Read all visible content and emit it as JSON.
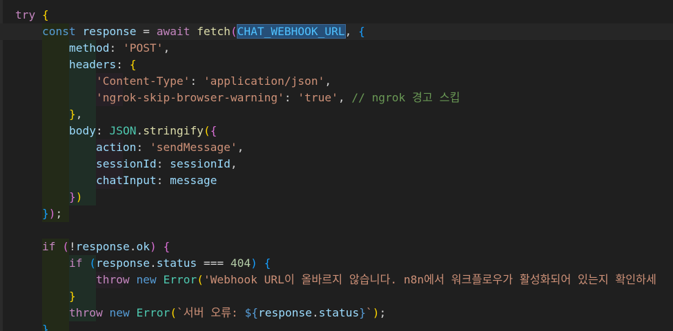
{
  "editor": {
    "language": "javascript",
    "highlighted_token": "CHAT_WEBHOOK_URL",
    "lines": [
      {
        "text": "try {"
      },
      {
        "text": "    const response = await fetch(CHAT_WEBHOOK_URL, {"
      },
      {
        "text": "        method: 'POST',"
      },
      {
        "text": "        headers: {"
      },
      {
        "text": "            'Content-Type': 'application/json',"
      },
      {
        "text": "            'ngrok-skip-browser-warning': 'true', // ngrok 경고 스킵"
      },
      {
        "text": "        },"
      },
      {
        "text": "        body: JSON.stringify({"
      },
      {
        "text": "            action: 'sendMessage',"
      },
      {
        "text": "            sessionId: sessionId,"
      },
      {
        "text": "            chatInput: message"
      },
      {
        "text": "        })"
      },
      {
        "text": "    });"
      },
      {
        "text": ""
      },
      {
        "text": "    if (!response.ok) {"
      },
      {
        "text": "        if (response.status === 404) {"
      },
      {
        "text": "            throw new Error('Webhook URL이 올바르지 않습니다. n8n에서 워크플로우가 활성화되어 있는지 확인하세"
      },
      {
        "text": "        }"
      },
      {
        "text": "        throw new Error(`서버 오류: ${response.status}`);"
      },
      {
        "text": "    }"
      }
    ]
  },
  "colors": {
    "background": "#1f1f1f",
    "keyword_control": "#c586c0",
    "keyword_storage": "#569cd6",
    "variable": "#9cdcfe",
    "constant": "#4fc1ff",
    "function": "#dcdcaa",
    "string": "#ce9178",
    "number": "#b5cea8",
    "type": "#4ec9b0",
    "comment": "#6a9955",
    "selection": "#264f78"
  }
}
